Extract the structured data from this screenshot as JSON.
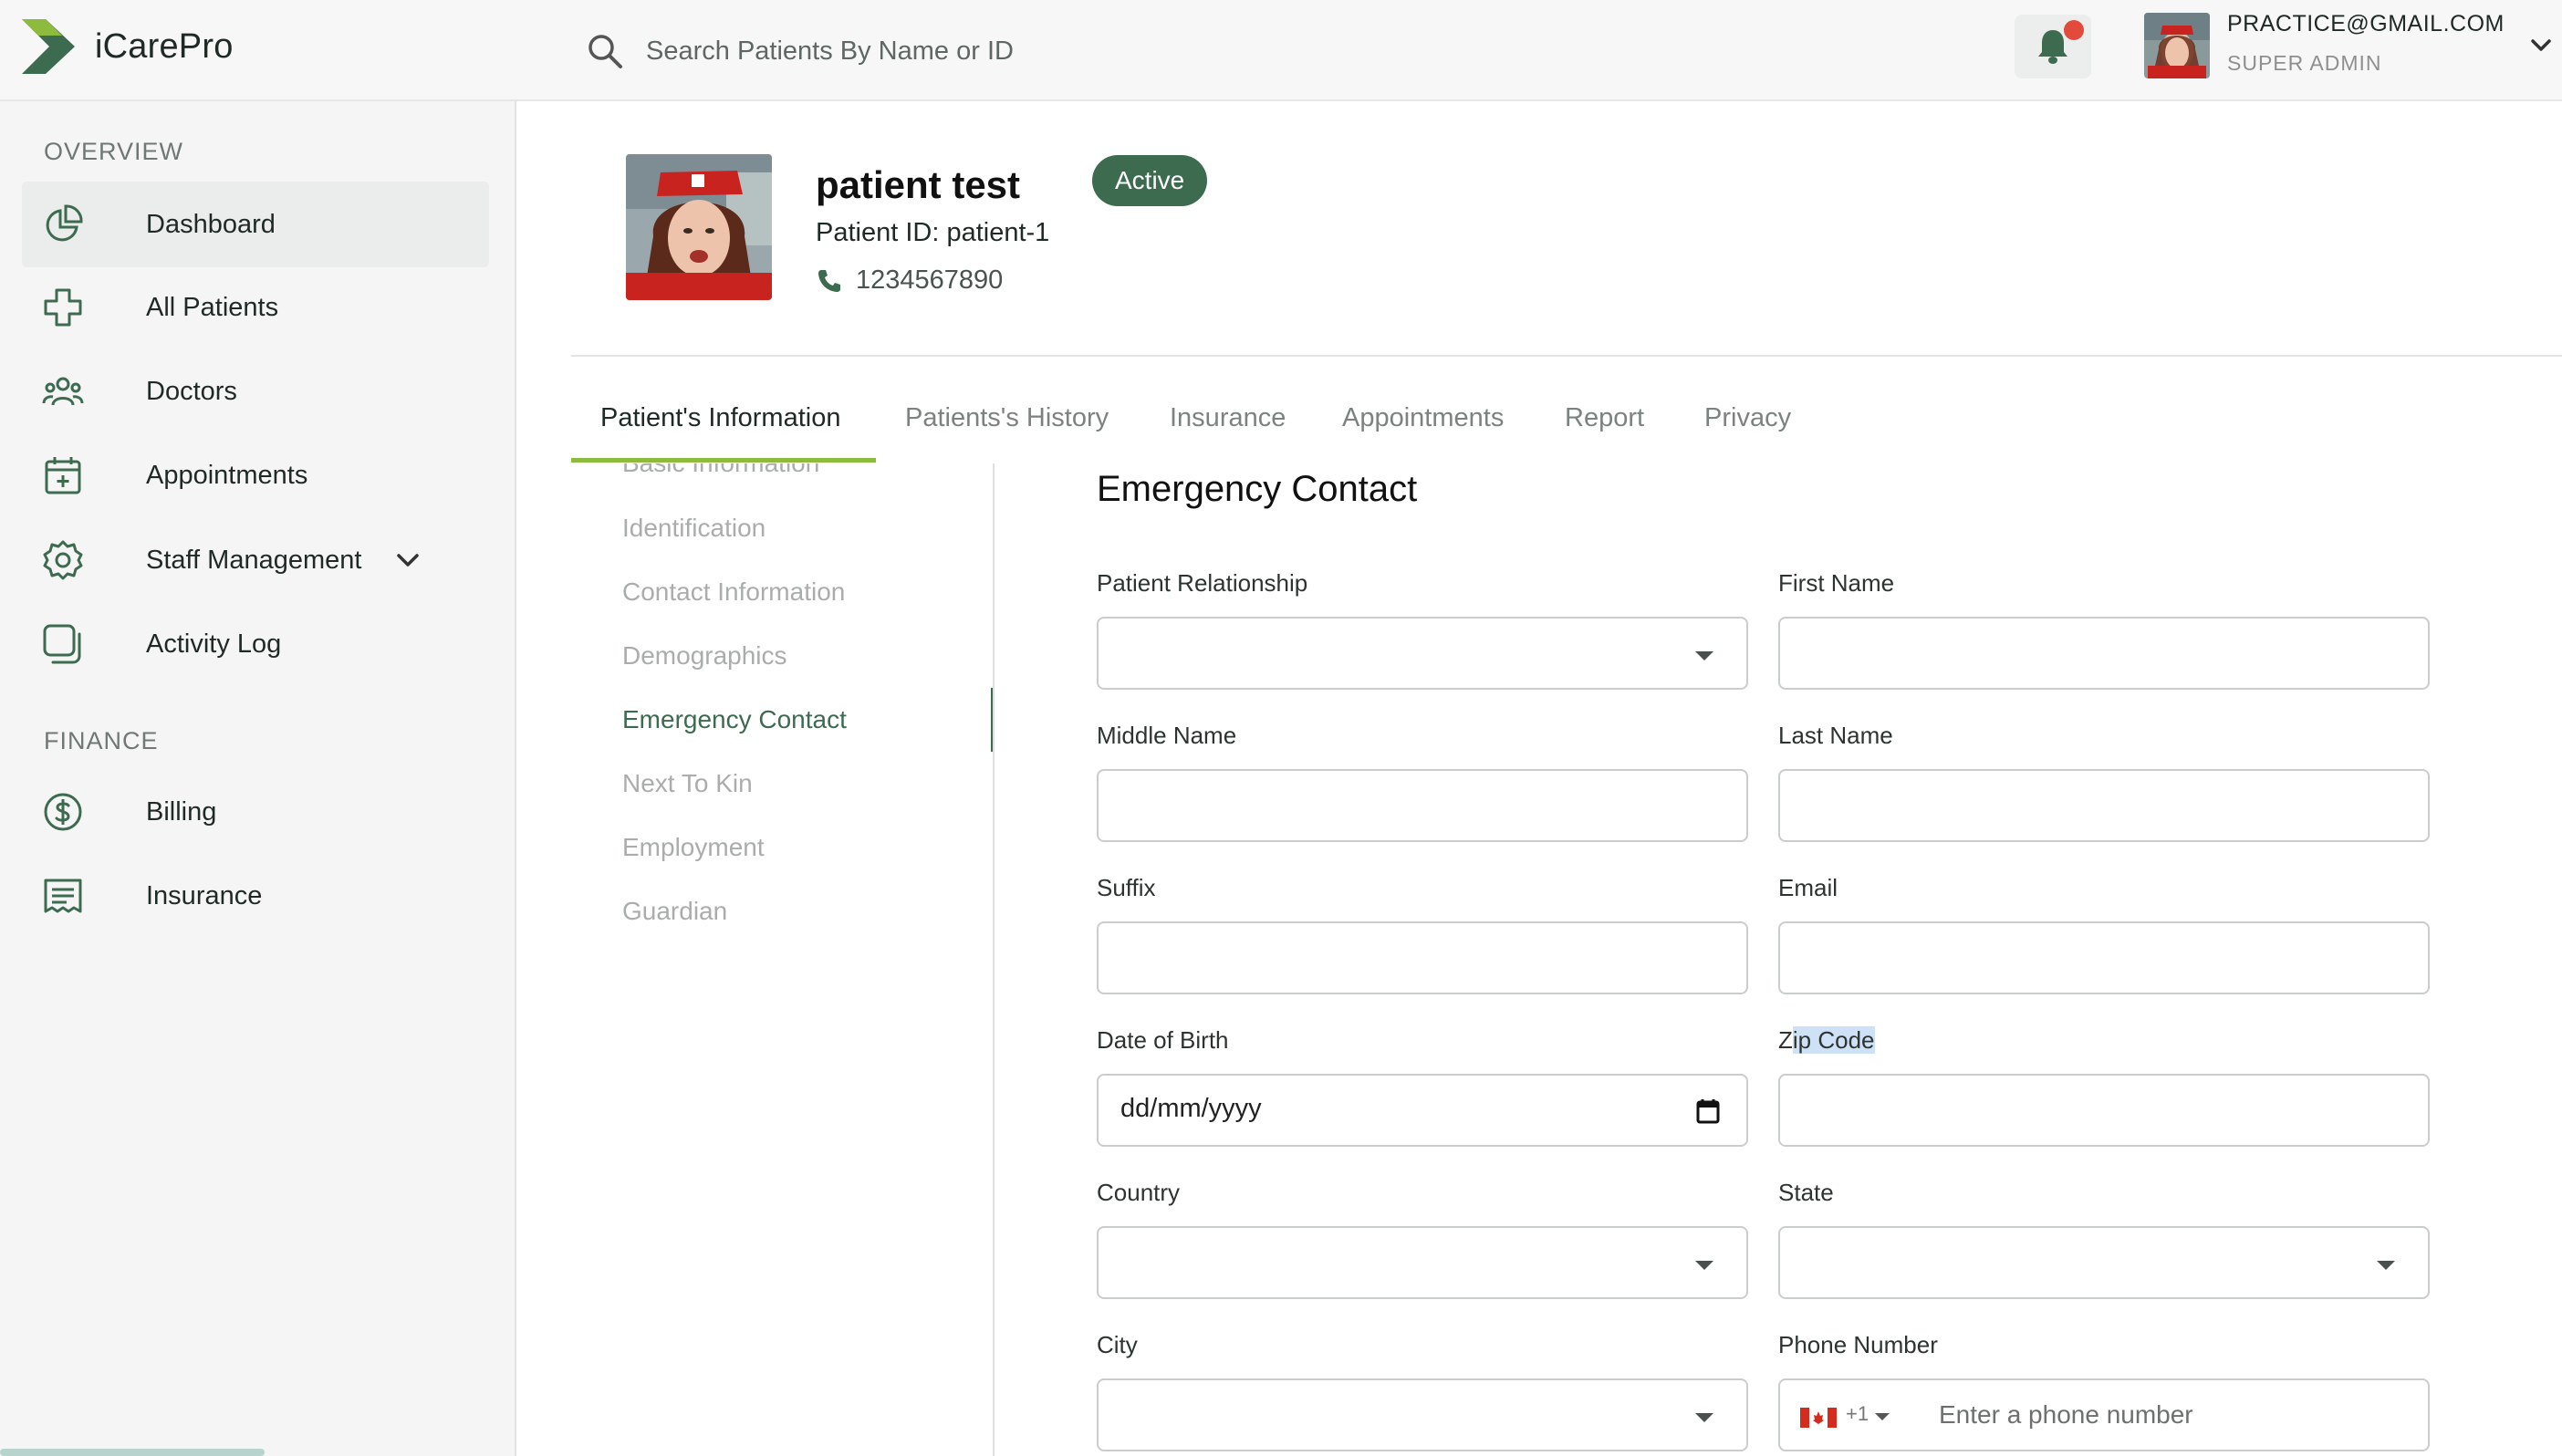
{
  "app": {
    "title": "iCarePro",
    "accent_color": "#3d6b50",
    "tab_underline_color": "#8dbb3d"
  },
  "header": {
    "search_placeholder": "Search Patients By Name or ID",
    "notification_icon": "bell-icon",
    "user_email": "PRACTICE@GMAIL.COM",
    "user_role": "SUPER ADMIN"
  },
  "sidebar": {
    "overview_label": "OVERVIEW",
    "finance_label": "FINANCE",
    "items": [
      {
        "label": "Dashboard",
        "icon": "pie-chart-icon"
      },
      {
        "label": "All Patients",
        "icon": "plus-cross-icon"
      },
      {
        "label": "Doctors",
        "icon": "people-icon"
      },
      {
        "label": "Appointments",
        "icon": "calendar-plus-icon"
      },
      {
        "label": "Staff Management",
        "icon": "gear-icon"
      },
      {
        "label": "Activity Log",
        "icon": "copy-icon"
      }
    ],
    "finance_items": [
      {
        "label": "Billing",
        "icon": "dollar-circle-icon"
      },
      {
        "label": "Insurance",
        "icon": "receipt-icon"
      }
    ]
  },
  "patient": {
    "name": "patient test",
    "id_text": "Patient ID: patient-1",
    "phone": "1234567890",
    "status": "Active"
  },
  "tabs": [
    "Patient's Information",
    "Patients's History",
    "Insurance",
    "Appointments",
    "Report",
    "Privacy"
  ],
  "subnav": [
    "Basic Information",
    "Identification",
    "Contact Information",
    "Demographics",
    "Emergency Contact",
    "Next To Kin",
    "Employment",
    "Guardian"
  ],
  "form": {
    "title": "Emergency Contact",
    "labels": {
      "relationship": "Patient Relationship",
      "first_name": "First Name",
      "middle_name": "Middle Name",
      "last_name": "Last Name",
      "suffix": "Suffix",
      "email": "Email",
      "dob": "Date of Birth",
      "zip_a": "Z",
      "zip_b": "ip Code",
      "country": "Country",
      "state": "State",
      "city": "City",
      "phone": "Phone Number"
    },
    "dob_placeholder": "dd/mm/yyyy",
    "phone_country_code": "+1",
    "phone_placeholder": "Enter a phone number"
  }
}
